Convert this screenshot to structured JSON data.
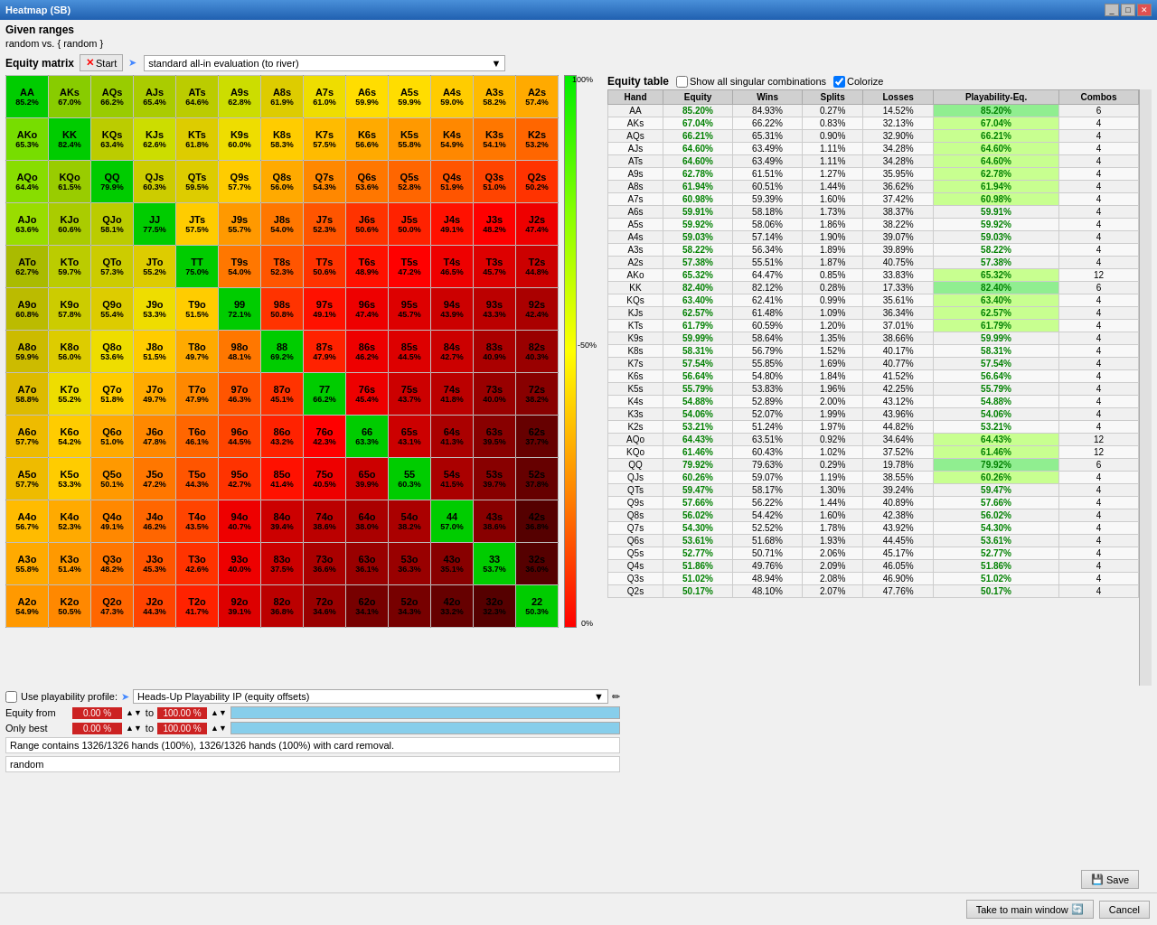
{
  "window": {
    "title": "Heatmap (SB)"
  },
  "given_ranges": {
    "label": "Given ranges",
    "text": "random vs. { random }"
  },
  "toolbar": {
    "equity_matrix_label": "Equity matrix",
    "start_label": "Start",
    "eval_label": "standard all-in evaluation (to river)"
  },
  "gradient": {
    "top_label": "100%",
    "mid_label": "~50%",
    "bot_label": "0%"
  },
  "equity_table": {
    "label": "Equity table",
    "show_singular_label": "Show all singular combinations",
    "colorize_label": "Colorize",
    "columns": [
      "Hand",
      "Equity",
      "Wins",
      "Splits",
      "Losses",
      "Playability-Eq.",
      "Combos"
    ]
  },
  "playability": {
    "use_label": "Use playability profile:",
    "profile_label": "Heads-Up Playability IP  (equity offsets)"
  },
  "equity_from": {
    "label": "Equity from",
    "from_val": "0.00 %",
    "to_val": "100.00 %"
  },
  "only_best": {
    "label": "Only best",
    "from_val": "0.00 %",
    "to_val": "100.00 %"
  },
  "status": {
    "text": "Range contains 1326/1326 hands (100%),  1326/1326 hands (100%) with card removal."
  },
  "random_label": "random",
  "buttons": {
    "take_main": "Take to main window",
    "cancel": "Cancel",
    "save": "Save"
  },
  "cells": [
    [
      "AA",
      "AKs",
      "AQs",
      "AJs",
      "ATs",
      "A9s",
      "A8s",
      "A7s",
      "A6s",
      "A5s",
      "A4s",
      "A3s",
      "A2s"
    ],
    [
      "AKo",
      "KK",
      "KQs",
      "KJs",
      "KTs",
      "K9s",
      "K8s",
      "K7s",
      "K6s",
      "K5s",
      "K4s",
      "K3s",
      "K2s"
    ],
    [
      "AQo",
      "KQo",
      "QQ",
      "QJs",
      "QTs",
      "Q9s",
      "Q8s",
      "Q7s",
      "Q6s",
      "Q5s",
      "Q4s",
      "Q3s",
      "Q2s"
    ],
    [
      "AJo",
      "KJo",
      "QJo",
      "JJ",
      "JTs",
      "J9s",
      "J8s",
      "J7s",
      "J6s",
      "J5s",
      "J4s",
      "J3s",
      "J2s"
    ],
    [
      "ATo",
      "KTo",
      "QTo",
      "JTo",
      "TT",
      "T9s",
      "T8s",
      "T7s",
      "T6s",
      "T5s",
      "T4s",
      "T3s",
      "T2s"
    ],
    [
      "A9o",
      "K9o",
      "Q9o",
      "J9o",
      "T9o",
      "99",
      "98s",
      "97s",
      "96s",
      "95s",
      "94s",
      "93s",
      "92s"
    ],
    [
      "A8o",
      "K8o",
      "Q8o",
      "J8o",
      "T8o",
      "98o",
      "88",
      "87s",
      "86s",
      "85s",
      "84s",
      "83s",
      "82s"
    ],
    [
      "A7o",
      "K7o",
      "Q7o",
      "J7o",
      "T7o",
      "97o",
      "87o",
      "77",
      "76s",
      "75s",
      "74s",
      "73s",
      "72s"
    ],
    [
      "A6o",
      "K6o",
      "Q6o",
      "J6o",
      "T6o",
      "96o",
      "86o",
      "76o",
      "66",
      "65s",
      "64s",
      "63s",
      "62s"
    ],
    [
      "A5o",
      "K5o",
      "Q5o",
      "J5o",
      "T5o",
      "95o",
      "85o",
      "75o",
      "65o",
      "55",
      "54s",
      "53s",
      "52s"
    ],
    [
      "A4o",
      "K4o",
      "Q4o",
      "J4o",
      "T4o",
      "94o",
      "84o",
      "74o",
      "64o",
      "54o",
      "44",
      "43s",
      "42s"
    ],
    [
      "A3o",
      "K3o",
      "Q3o",
      "J3o",
      "T3o",
      "93o",
      "83o",
      "73o",
      "63o",
      "53o",
      "43o",
      "33",
      "32s"
    ],
    [
      "A2o",
      "K2o",
      "Q2o",
      "J2o",
      "T2o",
      "92o",
      "82o",
      "72o",
      "62o",
      "52o",
      "42o",
      "32o",
      "22"
    ]
  ],
  "cell_pcts": [
    [
      "85.2%",
      "67.0%",
      "66.2%",
      "65.4%",
      "64.6%",
      "62.8%",
      "61.9%",
      "61.0%",
      "59.9%",
      "59.9%",
      "59.0%",
      "58.2%",
      "57.4%"
    ],
    [
      "65.3%",
      "82.4%",
      "63.4%",
      "62.6%",
      "61.8%",
      "60.0%",
      "58.3%",
      "57.5%",
      "56.6%",
      "55.8%",
      "54.9%",
      "54.1%",
      "53.2%"
    ],
    [
      "64.4%",
      "61.5%",
      "79.9%",
      "60.3%",
      "59.5%",
      "57.7%",
      "56.0%",
      "54.3%",
      "53.6%",
      "52.8%",
      "51.9%",
      "51.0%",
      "50.2%"
    ],
    [
      "63.6%",
      "60.6%",
      "58.1%",
      "77.5%",
      "57.5%",
      "55.7%",
      "54.0%",
      "52.3%",
      "50.6%",
      "50.0%",
      "49.1%",
      "48.2%",
      "47.4%"
    ],
    [
      "62.7%",
      "59.7%",
      "57.3%",
      "55.2%",
      "75.0%",
      "54.0%",
      "52.3%",
      "50.6%",
      "48.9%",
      "47.2%",
      "46.5%",
      "45.7%",
      "44.8%"
    ],
    [
      "60.8%",
      "57.8%",
      "55.4%",
      "53.3%",
      "51.5%",
      "72.1%",
      "50.8%",
      "49.1%",
      "47.4%",
      "45.7%",
      "43.9%",
      "43.3%",
      "42.4%"
    ],
    [
      "59.9%",
      "56.0%",
      "53.6%",
      "51.5%",
      "49.7%",
      "48.1%",
      "69.2%",
      "47.9%",
      "46.2%",
      "44.5%",
      "42.7%",
      "40.9%",
      "40.3%"
    ],
    [
      "58.8%",
      "55.2%",
      "51.8%",
      "49.7%",
      "47.9%",
      "46.3%",
      "45.1%",
      "66.2%",
      "45.4%",
      "43.7%",
      "41.8%",
      "40.0%",
      "38.2%"
    ],
    [
      "57.7%",
      "54.2%",
      "51.0%",
      "47.8%",
      "46.1%",
      "44.5%",
      "43.2%",
      "42.3%",
      "63.3%",
      "43.1%",
      "41.3%",
      "39.5%",
      "37.7%"
    ],
    [
      "57.7%",
      "53.3%",
      "50.1%",
      "47.2%",
      "44.3%",
      "42.7%",
      "41.4%",
      "40.5%",
      "39.9%",
      "60.3%",
      "41.5%",
      "39.7%",
      "37.8%"
    ],
    [
      "56.7%",
      "52.3%",
      "49.1%",
      "46.2%",
      "43.5%",
      "40.7%",
      "39.4%",
      "38.6%",
      "38.0%",
      "38.2%",
      "57.0%",
      "38.6%",
      "36.8%"
    ],
    [
      "55.8%",
      "51.4%",
      "48.2%",
      "45.3%",
      "42.6%",
      "40.0%",
      "37.5%",
      "36.6%",
      "36.1%",
      "36.3%",
      "35.1%",
      "53.7%",
      "36.0%"
    ],
    [
      "54.9%",
      "50.5%",
      "47.3%",
      "44.3%",
      "41.7%",
      "39.1%",
      "36.8%",
      "34.6%",
      "34.1%",
      "34.3%",
      "33.2%",
      "32.3%",
      "50.3%"
    ]
  ],
  "cell_colors": [
    [
      "#00cc00",
      "#88cc00",
      "#99cc00",
      "#aacc00",
      "#bbcc00",
      "#ccdd00",
      "#ddcc00",
      "#eedd00",
      "#ffdd00",
      "#ffdd00",
      "#ffcc00",
      "#ffbb00",
      "#ffaa00"
    ],
    [
      "#77dd00",
      "#00cc00",
      "#bbcc00",
      "#ccdd00",
      "#ddcc00",
      "#eedd00",
      "#ffcc00",
      "#ffbb00",
      "#ffaa00",
      "#ff9900",
      "#ff8800",
      "#ff7700",
      "#ff6600"
    ],
    [
      "#88dd00",
      "#99cc00",
      "#00cc00",
      "#cccc00",
      "#ddcc00",
      "#ffcc00",
      "#ffaa00",
      "#ff8800",
      "#ff7700",
      "#ff6600",
      "#ff5500",
      "#ff4400",
      "#ff3300"
    ],
    [
      "#99dd00",
      "#aacc00",
      "#bbcc00",
      "#00cc00",
      "#ffcc00",
      "#ff9900",
      "#ff7700",
      "#ff5500",
      "#ff3300",
      "#ff2200",
      "#ff1100",
      "#ff0000",
      "#ee0000"
    ],
    [
      "#aabb00",
      "#bbcc00",
      "#cccc00",
      "#ddcc00",
      "#00cc00",
      "#ff7700",
      "#ff5500",
      "#ff3300",
      "#ff1100",
      "#ff0000",
      "#ee0000",
      "#dd0000",
      "#cc0000"
    ],
    [
      "#bbbb00",
      "#cccc00",
      "#ddcc00",
      "#eedd00",
      "#ffcc00",
      "#00cc00",
      "#ff3300",
      "#ff1100",
      "#ee0000",
      "#dd0000",
      "#cc0000",
      "#bb0000",
      "#aa0000"
    ],
    [
      "#ccbb00",
      "#ddcc00",
      "#eedd00",
      "#ffcc00",
      "#ffaa00",
      "#ff7700",
      "#00cc00",
      "#ff2200",
      "#ee0000",
      "#dd0000",
      "#cc0000",
      "#aa0000",
      "#990000"
    ],
    [
      "#ddbb00",
      "#eedd00",
      "#ffcc00",
      "#ffaa00",
      "#ff8800",
      "#ff5500",
      "#ff3300",
      "#00cc00",
      "#ee0000",
      "#cc0000",
      "#bb0000",
      "#990000",
      "#880000"
    ],
    [
      "#eebb00",
      "#ffcc00",
      "#ffaa00",
      "#ff8800",
      "#ff6600",
      "#ff4400",
      "#ff2200",
      "#ff0000",
      "#00cc00",
      "#cc0000",
      "#aa0000",
      "#880000",
      "#660000"
    ],
    [
      "#eebb00",
      "#ffcc00",
      "#ff9900",
      "#ff7700",
      "#ff5500",
      "#ff3300",
      "#ff1100",
      "#ee0000",
      "#cc0000",
      "#00cc00",
      "#aa0000",
      "#880000",
      "#660000"
    ],
    [
      "#ffbb00",
      "#ffaa00",
      "#ff8800",
      "#ff6600",
      "#ff4400",
      "#ee0000",
      "#cc0000",
      "#bb0000",
      "#aa0000",
      "#aa0000",
      "#00cc00",
      "#880000",
      "#550000"
    ],
    [
      "#ffaa00",
      "#ff9900",
      "#ff7700",
      "#ff5500",
      "#ff3300",
      "#ee0000",
      "#cc0000",
      "#aa0000",
      "#990000",
      "#990000",
      "#880000",
      "#00cc00",
      "#550000"
    ],
    [
      "#ff9900",
      "#ff8800",
      "#ff6600",
      "#ff4400",
      "#ff2200",
      "#dd0000",
      "#bb0000",
      "#990000",
      "#770000",
      "#770000",
      "#660000",
      "#550000",
      "#00cc00"
    ]
  ],
  "equity_rows": [
    {
      "hand": "AA",
      "equity": "85.20%",
      "wins": "84.93%",
      "splits": "0.27%",
      "losses": "14.52%",
      "pe": "85.20%",
      "combos": "6"
    },
    {
      "hand": "AKs",
      "equity": "67.04%",
      "wins": "66.22%",
      "splits": "0.83%",
      "losses": "32.13%",
      "pe": "67.04%",
      "combos": "4"
    },
    {
      "hand": "AQs",
      "equity": "66.21%",
      "wins": "65.31%",
      "splits": "0.90%",
      "losses": "32.90%",
      "pe": "66.21%",
      "combos": "4"
    },
    {
      "hand": "AJs",
      "equity": "64.60%",
      "wins": "63.49%",
      "splits": "1.11%",
      "losses": "34.28%",
      "pe": "64.60%",
      "combos": "4"
    },
    {
      "hand": "ATs",
      "equity": "64.60%",
      "wins": "63.49%",
      "splits": "1.11%",
      "losses": "34.28%",
      "pe": "64.60%",
      "combos": "4"
    },
    {
      "hand": "A9s",
      "equity": "62.78%",
      "wins": "61.51%",
      "splits": "1.27%",
      "losses": "35.95%",
      "pe": "62.78%",
      "combos": "4"
    },
    {
      "hand": "A8s",
      "equity": "61.94%",
      "wins": "60.51%",
      "splits": "1.44%",
      "losses": "36.62%",
      "pe": "61.94%",
      "combos": "4"
    },
    {
      "hand": "A7s",
      "equity": "60.98%",
      "wins": "59.39%",
      "splits": "1.60%",
      "losses": "37.42%",
      "pe": "60.98%",
      "combos": "4"
    },
    {
      "hand": "A6s",
      "equity": "59.91%",
      "wins": "58.18%",
      "splits": "1.73%",
      "losses": "38.37%",
      "pe": "59.91%",
      "combos": "4"
    },
    {
      "hand": "A5s",
      "equity": "59.92%",
      "wins": "58.06%",
      "splits": "1.86%",
      "losses": "38.22%",
      "pe": "59.92%",
      "combos": "4"
    },
    {
      "hand": "A4s",
      "equity": "59.03%",
      "wins": "57.14%",
      "splits": "1.90%",
      "losses": "39.07%",
      "pe": "59.03%",
      "combos": "4"
    },
    {
      "hand": "A3s",
      "equity": "58.22%",
      "wins": "56.34%",
      "splits": "1.89%",
      "losses": "39.89%",
      "pe": "58.22%",
      "combos": "4"
    },
    {
      "hand": "A2s",
      "equity": "57.38%",
      "wins": "55.51%",
      "splits": "1.87%",
      "losses": "40.75%",
      "pe": "57.38%",
      "combos": "4"
    },
    {
      "hand": "AKo",
      "equity": "65.32%",
      "wins": "64.47%",
      "splits": "0.85%",
      "losses": "33.83%",
      "pe": "65.32%",
      "combos": "12"
    },
    {
      "hand": "KK",
      "equity": "82.40%",
      "wins": "82.12%",
      "splits": "0.28%",
      "losses": "17.33%",
      "pe": "82.40%",
      "combos": "6"
    },
    {
      "hand": "KQs",
      "equity": "63.40%",
      "wins": "62.41%",
      "splits": "0.99%",
      "losses": "35.61%",
      "pe": "63.40%",
      "combos": "4"
    },
    {
      "hand": "KJs",
      "equity": "62.57%",
      "wins": "61.48%",
      "splits": "1.09%",
      "losses": "36.34%",
      "pe": "62.57%",
      "combos": "4"
    },
    {
      "hand": "KTs",
      "equity": "61.79%",
      "wins": "60.59%",
      "splits": "1.20%",
      "losses": "37.01%",
      "pe": "61.79%",
      "combos": "4"
    },
    {
      "hand": "K9s",
      "equity": "59.99%",
      "wins": "58.64%",
      "splits": "1.35%",
      "losses": "38.66%",
      "pe": "59.99%",
      "combos": "4"
    },
    {
      "hand": "K8s",
      "equity": "58.31%",
      "wins": "56.79%",
      "splits": "1.52%",
      "losses": "40.17%",
      "pe": "58.31%",
      "combos": "4"
    },
    {
      "hand": "K7s",
      "equity": "57.54%",
      "wins": "55.85%",
      "splits": "1.69%",
      "losses": "40.77%",
      "pe": "57.54%",
      "combos": "4"
    },
    {
      "hand": "K6s",
      "equity": "56.64%",
      "wins": "54.80%",
      "splits": "1.84%",
      "losses": "41.52%",
      "pe": "56.64%",
      "combos": "4"
    },
    {
      "hand": "K5s",
      "equity": "55.79%",
      "wins": "53.83%",
      "splits": "1.96%",
      "losses": "42.25%",
      "pe": "55.79%",
      "combos": "4"
    },
    {
      "hand": "K4s",
      "equity": "54.88%",
      "wins": "52.89%",
      "splits": "2.00%",
      "losses": "43.12%",
      "pe": "54.88%",
      "combos": "4"
    },
    {
      "hand": "K3s",
      "equity": "54.06%",
      "wins": "52.07%",
      "splits": "1.99%",
      "losses": "43.96%",
      "pe": "54.06%",
      "combos": "4"
    },
    {
      "hand": "K2s",
      "equity": "53.21%",
      "wins": "51.24%",
      "splits": "1.97%",
      "losses": "44.82%",
      "pe": "53.21%",
      "combos": "4"
    },
    {
      "hand": "AQo",
      "equity": "64.43%",
      "wins": "63.51%",
      "splits": "0.92%",
      "losses": "34.64%",
      "pe": "64.43%",
      "combos": "12"
    },
    {
      "hand": "KQo",
      "equity": "61.46%",
      "wins": "60.43%",
      "splits": "1.02%",
      "losses": "37.52%",
      "pe": "61.46%",
      "combos": "12"
    },
    {
      "hand": "QQ",
      "equity": "79.92%",
      "wins": "79.63%",
      "splits": "0.29%",
      "losses": "19.78%",
      "pe": "79.92%",
      "combos": "6"
    },
    {
      "hand": "QJs",
      "equity": "60.26%",
      "wins": "59.07%",
      "splits": "1.19%",
      "losses": "38.55%",
      "pe": "60.26%",
      "combos": "4"
    },
    {
      "hand": "QTs",
      "equity": "59.47%",
      "wins": "58.17%",
      "splits": "1.30%",
      "losses": "39.24%",
      "pe": "59.47%",
      "combos": "4"
    },
    {
      "hand": "Q9s",
      "equity": "57.66%",
      "wins": "56.22%",
      "splits": "1.44%",
      "losses": "40.89%",
      "pe": "57.66%",
      "combos": "4"
    },
    {
      "hand": "Q8s",
      "equity": "56.02%",
      "wins": "54.42%",
      "splits": "1.60%",
      "losses": "42.38%",
      "pe": "56.02%",
      "combos": "4"
    },
    {
      "hand": "Q7s",
      "equity": "54.30%",
      "wins": "52.52%",
      "splits": "1.78%",
      "losses": "43.92%",
      "pe": "54.30%",
      "combos": "4"
    },
    {
      "hand": "Q6s",
      "equity": "53.61%",
      "wins": "51.68%",
      "splits": "1.93%",
      "losses": "44.45%",
      "pe": "53.61%",
      "combos": "4"
    },
    {
      "hand": "Q5s",
      "equity": "52.77%",
      "wins": "50.71%",
      "splits": "2.06%",
      "losses": "45.17%",
      "pe": "52.77%",
      "combos": "4"
    },
    {
      "hand": "Q4s",
      "equity": "51.86%",
      "wins": "49.76%",
      "splits": "2.09%",
      "losses": "46.05%",
      "pe": "51.86%",
      "combos": "4"
    },
    {
      "hand": "Q3s",
      "equity": "51.02%",
      "wins": "48.94%",
      "splits": "2.08%",
      "losses": "46.90%",
      "pe": "51.02%",
      "combos": "4"
    },
    {
      "hand": "Q2s",
      "equity": "50.17%",
      "wins": "48.10%",
      "splits": "2.07%",
      "losses": "47.76%",
      "pe": "50.17%",
      "combos": "4"
    }
  ]
}
